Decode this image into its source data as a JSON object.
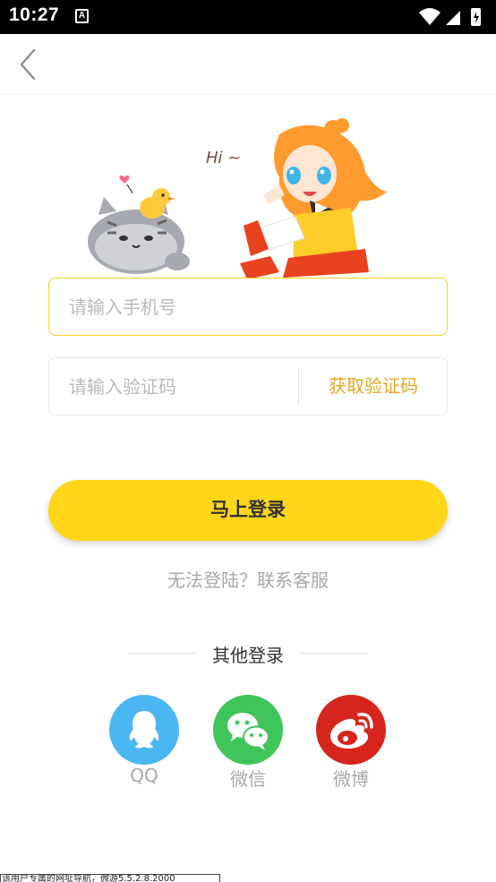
{
  "status_bar": {
    "time": "10:27",
    "notification_icon": "a-icon"
  },
  "topbar": {
    "back_icon": "chevron-left-icon"
  },
  "hero": {
    "greeting": "Hi ~"
  },
  "form": {
    "phone_placeholder": "请输入手机号",
    "phone_value": "",
    "code_placeholder": "请输入验证码",
    "code_value": "",
    "get_code_label": "获取验证码",
    "login_label": "马上登录",
    "cant_login": "无法登陆？联系客服"
  },
  "other_login": {
    "title": "其他登录",
    "providers": [
      {
        "label": "QQ",
        "icon": "qq-icon",
        "color": "#4ab7f2"
      },
      {
        "label": "微信",
        "icon": "wechat-icon",
        "color": "#3fc559"
      },
      {
        "label": "微博",
        "icon": "weibo-icon",
        "color": "#d6251c"
      }
    ]
  },
  "bottom_note": "该用户专属的网址导航，微游5.5.2.8.2000",
  "colors": {
    "accent": "#ffd617",
    "accent_border": "#f7cf2a",
    "link_orange": "#e6a820",
    "muted_text": "#a8a8a8"
  }
}
